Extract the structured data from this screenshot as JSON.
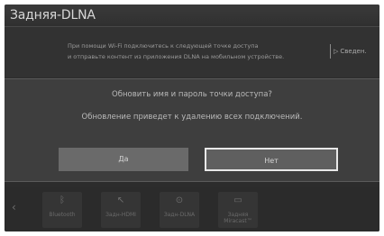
{
  "header": {
    "title": "Задняя-DLNA"
  },
  "info": {
    "text": "При помощи Wi-Fi подключитесь к следующей точке доступа\nи отправьте контент из приложения DLNA на мобильном устройстве.",
    "link_label": "Сведен."
  },
  "dialog": {
    "question": "Обновить имя и пароль точки доступа?",
    "note": "Обновление приведет к удалению всех подключений.",
    "yes_label": "Да",
    "no_label": "Нет"
  },
  "bottom": {
    "items": [
      {
        "label": "Bluetooth",
        "icon": "bluetooth-icon"
      },
      {
        "label": "Задн-HDMI",
        "icon": "hdmi-icon"
      },
      {
        "label": "Задн-DLNA",
        "icon": "dlna-icon"
      },
      {
        "label": "Задняя Miracast™",
        "icon": "miracast-icon"
      }
    ]
  }
}
